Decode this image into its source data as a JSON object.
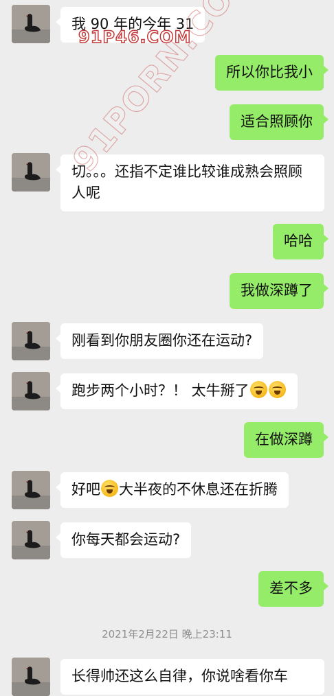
{
  "messages": [
    {
      "side": "left",
      "text": "我 90 年的今年 31"
    },
    {
      "side": "right",
      "text": "所以你比我小"
    },
    {
      "side": "right",
      "text": "适合照顾你"
    },
    {
      "side": "left",
      "text": "切。。。还指不定谁比较谁成熟会照顾人呢"
    },
    {
      "side": "right",
      "text": "哈哈"
    },
    {
      "side": "right",
      "text": "我做深蹲了"
    },
    {
      "side": "left",
      "text": "刚看到你朋友圈你还在运动?"
    },
    {
      "side": "left",
      "text": "跑步两个小时？！ 太牛掰了",
      "emoji_after": [
        "laughing-crying-emoji",
        "laughing-crying-emoji"
      ]
    },
    {
      "side": "right",
      "text": "在做深蹲"
    },
    {
      "side": "left",
      "text_before": "好吧",
      "emoji_mid": "laughing-crying-emoji",
      "text_after": "大半夜的不休息还在折腾"
    },
    {
      "side": "left",
      "text": "你每天都会运动?"
    },
    {
      "side": "right",
      "text": "差不多"
    }
  ],
  "timestamp": "2021年2月22日 晚上23:11",
  "last_message_partial": "长得帅还这么自律，你说啥看你车",
  "watermark": {
    "small": "91P46.COM",
    "large": "91PORN.COM"
  },
  "colors": {
    "background": "#ededed",
    "incoming_bubble": "#ffffff",
    "outgoing_bubble": "#95ec69",
    "timestamp_text": "#8e8e8e"
  }
}
